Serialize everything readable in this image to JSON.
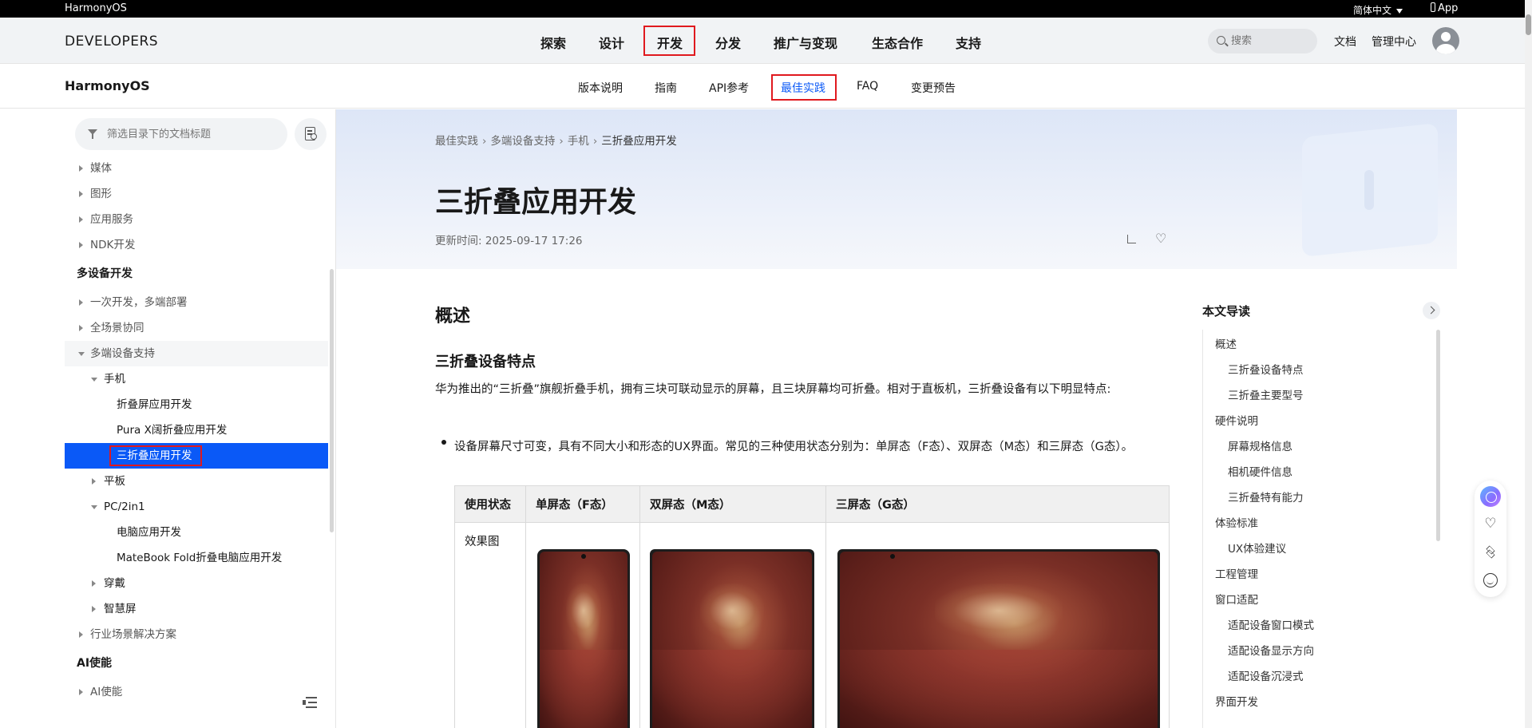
{
  "topbar": {
    "brand": "HarmonyOS",
    "language": "简体中文",
    "app": "App"
  },
  "header": {
    "logo": "DEVELOPERS",
    "nav": [
      "探索",
      "设计",
      "开发",
      "分发",
      "推广与变现",
      "生态合作",
      "支持"
    ],
    "active_nav": "开发",
    "search_placeholder": "搜索",
    "doc_link": "文档",
    "management_link": "管理中心"
  },
  "subnav": {
    "logo": "HarmonyOS",
    "tabs": [
      "版本说明",
      "指南",
      "API参考",
      "最佳实践",
      "FAQ",
      "变更预告"
    ],
    "active_tab": "最佳实践"
  },
  "sidebar": {
    "filter_placeholder": "筛选目录下的文档标题",
    "items": [
      {
        "label": "媒体",
        "level": 0,
        "state": "collapsed"
      },
      {
        "label": "图形",
        "level": 0,
        "state": "collapsed"
      },
      {
        "label": "应用服务",
        "level": 0,
        "state": "collapsed"
      },
      {
        "label": "NDK开发",
        "level": 0,
        "state": "collapsed"
      },
      {
        "label": "多设备开发",
        "level": "group"
      },
      {
        "label": "一次开发，多端部署",
        "level": 0,
        "state": "collapsed"
      },
      {
        "label": "全场景协同",
        "level": 0,
        "state": "collapsed"
      },
      {
        "label": "多端设备支持",
        "level": 0,
        "state": "expanded"
      },
      {
        "label": "手机",
        "level": 1,
        "state": "expanded"
      },
      {
        "label": "折叠屏应用开发",
        "level": 2
      },
      {
        "label": "Pura X阔折叠应用开发",
        "level": 2
      },
      {
        "label": "三折叠应用开发",
        "level": 2,
        "selected": true
      },
      {
        "label": "平板",
        "level": 1,
        "state": "collapsed"
      },
      {
        "label": "PC/2in1",
        "level": 1,
        "state": "expanded"
      },
      {
        "label": "电脑应用开发",
        "level": 2
      },
      {
        "label": "MateBook Fold折叠电脑应用开发",
        "level": 2
      },
      {
        "label": "穿戴",
        "level": 1,
        "state": "collapsed"
      },
      {
        "label": "智慧屏",
        "level": 1,
        "state": "collapsed"
      },
      {
        "label": "行业场景解决方案",
        "level": 0,
        "state": "collapsed"
      },
      {
        "label": "AI使能",
        "level": "group"
      },
      {
        "label": "AI使能",
        "level": 0,
        "state": "collapsed"
      }
    ]
  },
  "article": {
    "breadcrumb": [
      "最佳实践",
      "多端设备支持",
      "手机",
      "三折叠应用开发"
    ],
    "title": "三折叠应用开发",
    "updated": "更新时间: 2025-09-17 17:26",
    "h2": "概述",
    "h3": "三折叠设备特点",
    "intro": "华为推出的“三折叠”旗舰折叠手机，拥有三块可联动显示的屏幕，且三块屏幕均可折叠。相对于直板机，三折叠设备有以下明显特点:",
    "bullet1": "设备屏幕尺寸可变，具有不同大小和形态的UX界面。常见的三种使用状态分别为：单屏态（F态）、双屏态（M态）和三屏态（G态）。",
    "table": {
      "headers": [
        "使用状态",
        "单屏态（F态）",
        "双屏态（M态）",
        "三屏态（G态）"
      ],
      "row_label": "效果图"
    }
  },
  "toc": {
    "title": "本文导读",
    "items": [
      {
        "label": "概述",
        "level": 0
      },
      {
        "label": "三折叠设备特点",
        "level": 1
      },
      {
        "label": "三折叠主要型号",
        "level": 1
      },
      {
        "label": "硬件说明",
        "level": 0
      },
      {
        "label": "屏幕规格信息",
        "level": 1
      },
      {
        "label": "相机硬件信息",
        "level": 1
      },
      {
        "label": "三折叠特有能力",
        "level": 1
      },
      {
        "label": "体验标准",
        "level": 0
      },
      {
        "label": "UX体验建议",
        "level": 1
      },
      {
        "label": "工程管理",
        "level": 0
      },
      {
        "label": "窗口适配",
        "level": 0
      },
      {
        "label": "适配设备窗口模式",
        "level": 1
      },
      {
        "label": "适配设备显示方向",
        "level": 1
      },
      {
        "label": "适配设备沉浸式",
        "level": 1
      },
      {
        "label": "界面开发",
        "level": 0
      }
    ]
  },
  "colors": {
    "accent": "#0a59f7",
    "highlight_box": "#e0191e"
  }
}
